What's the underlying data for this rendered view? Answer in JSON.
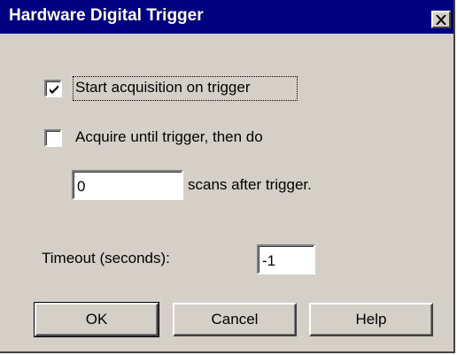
{
  "window": {
    "title": "Hardware Digital Trigger",
    "close_icon": "close-icon"
  },
  "options": {
    "start_on_trigger": {
      "label": "Start acquisition on trigger",
      "checked": true
    },
    "acquire_until": {
      "label": "Acquire until trigger, then do",
      "checked": false
    }
  },
  "scans": {
    "value": "0",
    "suffix": "scans after trigger."
  },
  "timeout": {
    "label": "Timeout (seconds):",
    "value": "-1"
  },
  "buttons": {
    "ok": "OK",
    "cancel": "Cancel",
    "help": "Help"
  }
}
